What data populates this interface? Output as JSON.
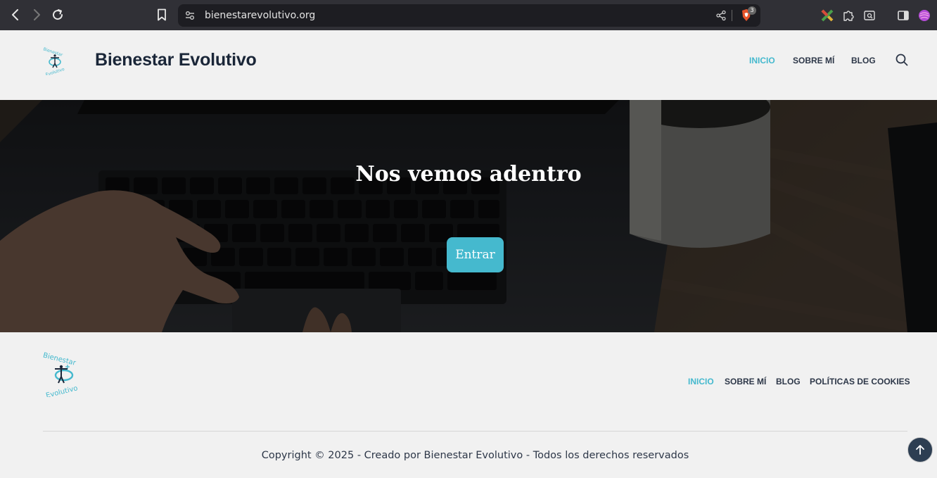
{
  "browser": {
    "url": "bienestarevolutivo.org",
    "shields_count": "3"
  },
  "header": {
    "site_title": "Bienestar Evolutivo",
    "nav": [
      {
        "label": "INICIO",
        "active": true
      },
      {
        "label": "SOBRE MÍ",
        "active": false
      },
      {
        "label": "BLOG",
        "active": false
      }
    ]
  },
  "hero": {
    "title": "Nos vemos adentro",
    "button_label": "Entrar"
  },
  "footer": {
    "nav": [
      {
        "label": "INICIO",
        "active": true
      },
      {
        "label": "SOBRE MÍ",
        "active": false
      },
      {
        "label": "BLOG",
        "active": false
      },
      {
        "label": "POLÍTICAS DE COOKIES",
        "active": false
      }
    ],
    "copyright": "Copyright © 2025 - Creado por Bienestar Evolutivo - Todos los derechos reservados",
    "logo_text_top": "Bienestar",
    "logo_text_bottom": "Evolutivo"
  },
  "colors": {
    "accent": "#45b9ce",
    "heading": "#1a2638",
    "nav_text": "#2d3748",
    "background": "#f1f1f1"
  }
}
